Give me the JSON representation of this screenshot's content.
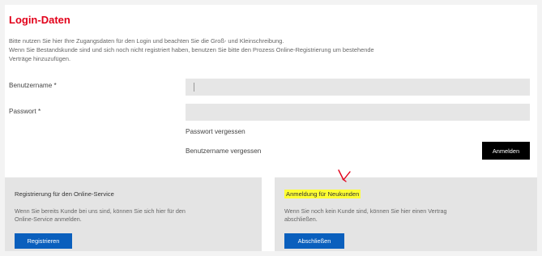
{
  "title": "Login-Daten",
  "intro": [
    "Bitte nutzen Sie hier Ihre Zugangsdaten für den Login und beachten Sie die Groß- und Kleinschreibung.",
    "Wenn Sie Bestandskunde sind und sich noch nicht registriert haben, benutzen Sie bitte den Prozess Online-Registrierung um bestehende",
    "Verträge hinzuzufügen."
  ],
  "form": {
    "username_label": "Benutzername *",
    "username_value": "",
    "password_label": "Passwort *",
    "password_value": "",
    "forgot_password": "Passwort vergessen",
    "forgot_username": "Benutzername vergessen",
    "login_button": "Anmelden"
  },
  "panels": {
    "register": {
      "title": "Registrierung für den Online-Service",
      "text": [
        "Wenn Sie bereits Kunde bei uns sind, können Sie sich hier für den",
        "Online-Service anmelden."
      ],
      "button": "Registrieren"
    },
    "new_customer": {
      "title": "Anmeldung für Neukunden",
      "text": [
        "Wenn Sie noch kein Kunde sind, können Sie hier einen Vertrag",
        "abschließen."
      ],
      "button": "Abschließen"
    }
  },
  "colors": {
    "brand_red": "#e2001a",
    "button_blue": "#0a5fbd",
    "highlight": "#ffff33",
    "annotation": "#e2001a"
  }
}
